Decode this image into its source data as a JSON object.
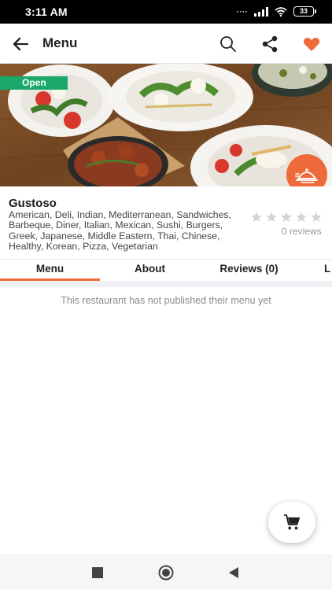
{
  "status_bar": {
    "time": "3:11 AM",
    "battery": "33"
  },
  "app_bar": {
    "title": "Menu",
    "icons": [
      "back-arrow-icon",
      "search-icon",
      "share-icon",
      "heart-icon"
    ],
    "favorite_color": "#ef6a3a"
  },
  "hero": {
    "badge": "Open",
    "badge_color": "#1aa86b",
    "delivery_icon": "food-cloche-icon",
    "accent_color": "#ef6a3a"
  },
  "restaurant": {
    "name": "Gustoso",
    "cuisines": "American, Deli, Indian, Mediterranean, Sandwiches, Barbeque, Diner, Italian, Mexican, Sushi, Burgers, Greek, Japanese, Middle Eastern, Thai, Chinese, Healthy, Korean, Pizza, Vegetarian",
    "rating": 0,
    "rating_max": 5,
    "reviews_label": "0 reviews"
  },
  "tabs": [
    {
      "label": "Menu",
      "active": true
    },
    {
      "label": "About",
      "active": false
    },
    {
      "label": "Reviews (0)",
      "active": false
    },
    {
      "label": "L",
      "active": false
    }
  ],
  "content": {
    "empty_message": "This restaurant has not published their menu yet"
  },
  "fab": {
    "icon": "cart-icon"
  },
  "nav_bar": {
    "icons": [
      "recents-square-icon",
      "home-circle-icon",
      "back-triangle-icon"
    ]
  }
}
